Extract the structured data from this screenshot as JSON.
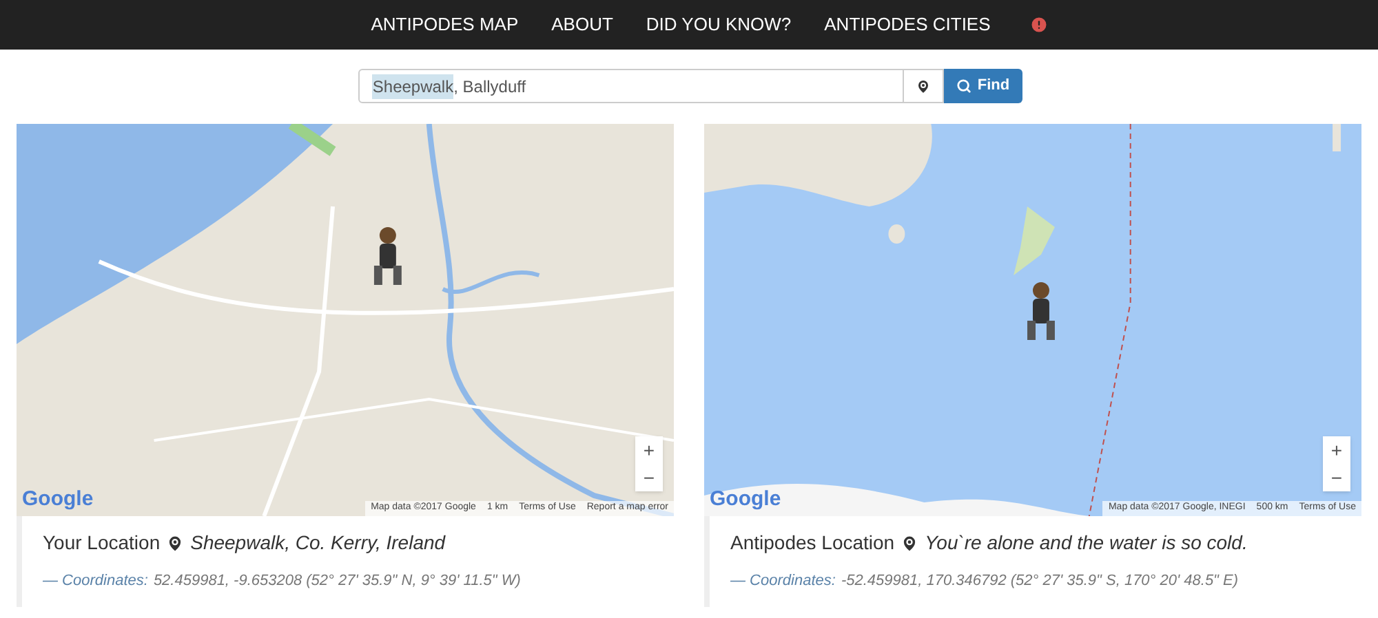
{
  "nav": {
    "items": [
      {
        "label": "ANTIPODES MAP"
      },
      {
        "label": "ABOUT"
      },
      {
        "label": "DID YOU KNOW?"
      },
      {
        "label": "ANTIPODES CITIES"
      }
    ],
    "alert": true
  },
  "search": {
    "value_parts": [
      {
        "text": "Sheepwalk",
        "highlighted": true
      },
      {
        "text": ", Ballyduff",
        "highlighted": false
      }
    ],
    "button": "Find"
  },
  "maps": [
    {
      "kind": "land",
      "logo": "Google",
      "zoom_in": "+",
      "zoom_out": "−",
      "attribution": [
        "Map data ©2017 Google",
        "1 km",
        "Terms of Use",
        "Report a map error"
      ],
      "caption": {
        "label": "Your Location",
        "place": "Sheepwalk, Co. Kerry, Ireland",
        "coords_label": "— Coordinates:",
        "coords": "52.459981, -9.653208 (52° 27' 35.9\" N, 9° 39' 11.5\" W)"
      }
    },
    {
      "kind": "ocean",
      "logo": "Google",
      "zoom_in": "+",
      "zoom_out": "−",
      "attribution": [
        "Map data ©2017 Google, INEGI",
        "500 km",
        "Terms of Use"
      ],
      "caption": {
        "label": "Antipodes Location",
        "place": "You`re alone and the water is so cold.",
        "coords_label": "— Coordinates:",
        "coords": "-52.459981, 170.346792 (52° 27' 35.9\" S, 170° 20' 48.5\" E)"
      }
    }
  ]
}
